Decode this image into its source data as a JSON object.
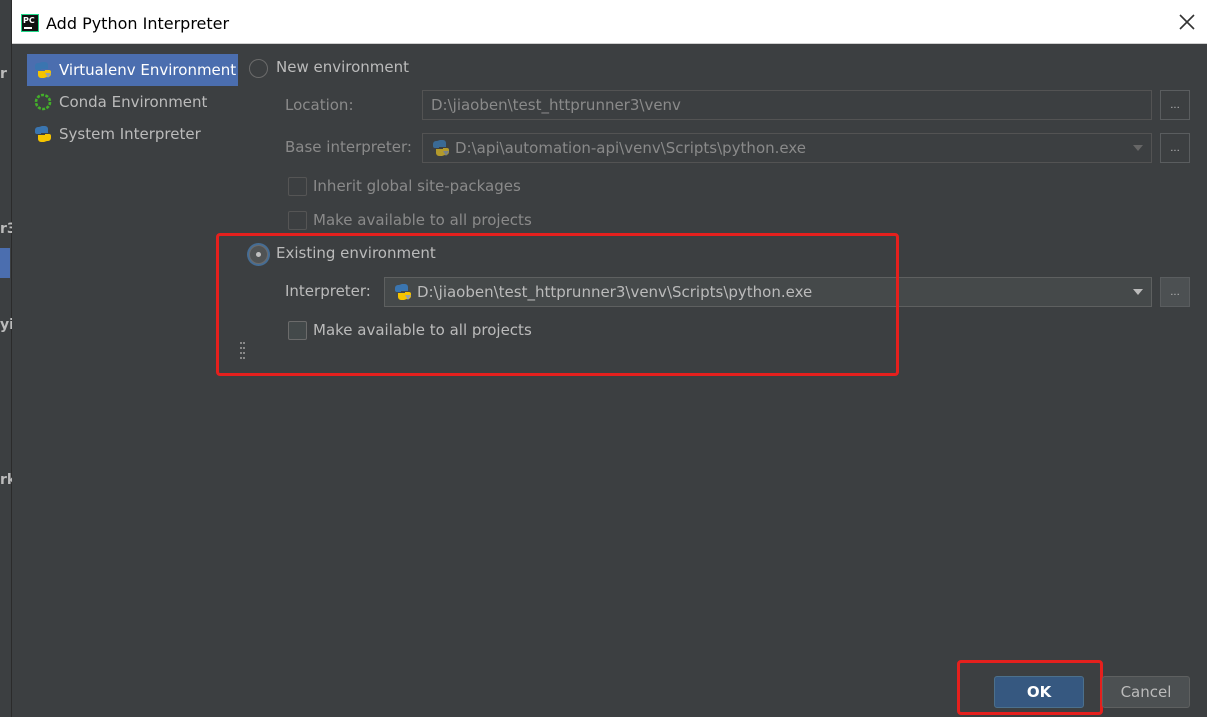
{
  "background_chars": [
    "r",
    "r3",
    "yi",
    "rk"
  ],
  "title": "Add Python Interpreter",
  "left_panel": {
    "items": [
      {
        "label": "Virtualenv Environment",
        "icon": "virtualenv-icon",
        "selected": true
      },
      {
        "label": "Conda Environment",
        "icon": "conda-icon",
        "selected": false
      },
      {
        "label": "System Interpreter",
        "icon": "python-icon",
        "selected": false
      }
    ]
  },
  "new_env": {
    "radio_label": "New environment",
    "selected": false,
    "location_label": "Location:",
    "location_value": "D:\\jiaoben\\test_httprunner3\\venv",
    "base_label": "Base interpreter:",
    "base_value": "D:\\api\\automation-api\\venv\\Scripts\\python.exe",
    "inherit_label": "Inherit global site-packages",
    "make_available_label": "Make available to all projects",
    "browse_label": "..."
  },
  "existing_env": {
    "radio_label": "Existing environment",
    "selected": true,
    "interpreter_label": "Interpreter:",
    "interpreter_value": "D:\\jiaoben\\test_httprunner3\\venv\\Scripts\\python.exe",
    "make_available_label": "Make available to all projects",
    "browse_label": "..."
  },
  "buttons": {
    "ok": "OK",
    "cancel": "Cancel"
  },
  "colors": {
    "highlight_box": "#e5201d",
    "selection": "#4b6eaf",
    "background": "#3c3f41",
    "ok_button": "#365880"
  }
}
